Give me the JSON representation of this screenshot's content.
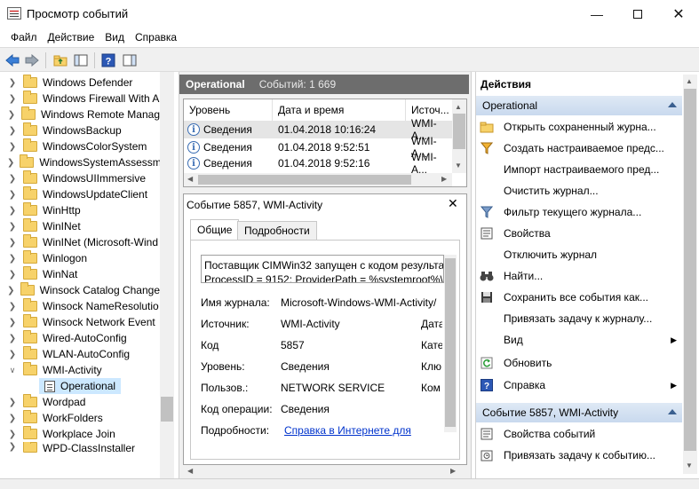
{
  "window": {
    "title": "Просмотр событий"
  },
  "menu": [
    "Файл",
    "Действие",
    "Вид",
    "Справка"
  ],
  "tree": {
    "items": [
      "Windows Defender",
      "Windows Firewall With A",
      "Windows Remote Manag",
      "WindowsBackup",
      "WindowsColorSystem",
      "WindowsSystemAssessm",
      "WindowsUIImmersive",
      "WindowsUpdateClient",
      "WinHttp",
      "WinINet",
      "WinINet (Microsoft-Wind",
      "Winlogon",
      "WinNat",
      "Winsock Catalog Change",
      "Winsock NameResolutio",
      "Winsock Network Event",
      "Wired-AutoConfig",
      "WLAN-AutoConfig",
      "WMI-Activity"
    ],
    "selected": "Operational",
    "after": [
      "Wordpad",
      "WorkFolders",
      "Workplace Join",
      "WPD-ClassInstaller"
    ]
  },
  "log": {
    "name": "Operational",
    "count": "Событий: 1 669",
    "columns": [
      "Уровень",
      "Дата и время",
      "Источ..."
    ],
    "rows": [
      {
        "level": "Сведения",
        "date": "01.04.2018 10:16:24",
        "source": "WMI-A..."
      },
      {
        "level": "Сведения",
        "date": "01.04.2018 9:52:51",
        "source": "WMI-A..."
      },
      {
        "level": "Сведения",
        "date": "01.04.2018 9:52:16",
        "source": "WMI-A..."
      }
    ]
  },
  "detail": {
    "title": "Событие 5857, WMI-Activity",
    "tabs": [
      "Общие",
      "Подробности"
    ],
    "message_line1": "Поставщик CIMWin32 запущен с кодом результа",
    "message_line2": "ProcessID = 9152; ProviderPath = %systemroot%\\s",
    "props": [
      {
        "label": "Имя журнала:",
        "value": "Microsoft-Windows-WMI-Activity/"
      },
      {
        "label": "Источник:",
        "value": "WMI-Activity",
        "extra": "Дата"
      },
      {
        "label": "Код",
        "value": "5857",
        "extra": "Кате"
      },
      {
        "label": "Уровень:",
        "value": "Сведения",
        "extra": "Клю"
      },
      {
        "label": "Пользов.:",
        "value": "NETWORK SERVICE",
        "extra": "Ком"
      },
      {
        "label": "Код операции:",
        "value": "Сведения"
      },
      {
        "label": "Подробности:",
        "value": "Справка в Интернете для"
      }
    ]
  },
  "actions": {
    "header": "Действия",
    "section1": "Operational",
    "items1": [
      {
        "label": "Открыть сохраненный журна...",
        "icon": "folder-open-icon"
      },
      {
        "label": "Создать настраиваемое предс...",
        "icon": "filter-icon"
      },
      {
        "label": "Импорт настраиваемого пред...",
        "icon": ""
      },
      {
        "label": "Очистить журнал...",
        "icon": ""
      },
      {
        "label": "Фильтр текущего журнала...",
        "icon": "filter-icon"
      },
      {
        "label": "Свойства",
        "icon": "properties-icon"
      },
      {
        "label": "Отключить журнал",
        "icon": ""
      },
      {
        "label": "Найти...",
        "icon": "binoculars-icon"
      },
      {
        "label": "Сохранить все события как...",
        "icon": "save-icon"
      },
      {
        "label": "Привязать задачу к журналу...",
        "icon": ""
      },
      {
        "label": "Вид",
        "icon": "",
        "submenu": true
      },
      {
        "label": "Обновить",
        "icon": "refresh-icon"
      },
      {
        "label": "Справка",
        "icon": "help-icon",
        "submenu": true
      }
    ],
    "section2": "Событие 5857, WMI-Activity",
    "items2": [
      {
        "label": "Свойства событий",
        "icon": "properties-icon"
      },
      {
        "label": "Привязать задачу к событию...",
        "icon": "task-icon"
      }
    ]
  }
}
